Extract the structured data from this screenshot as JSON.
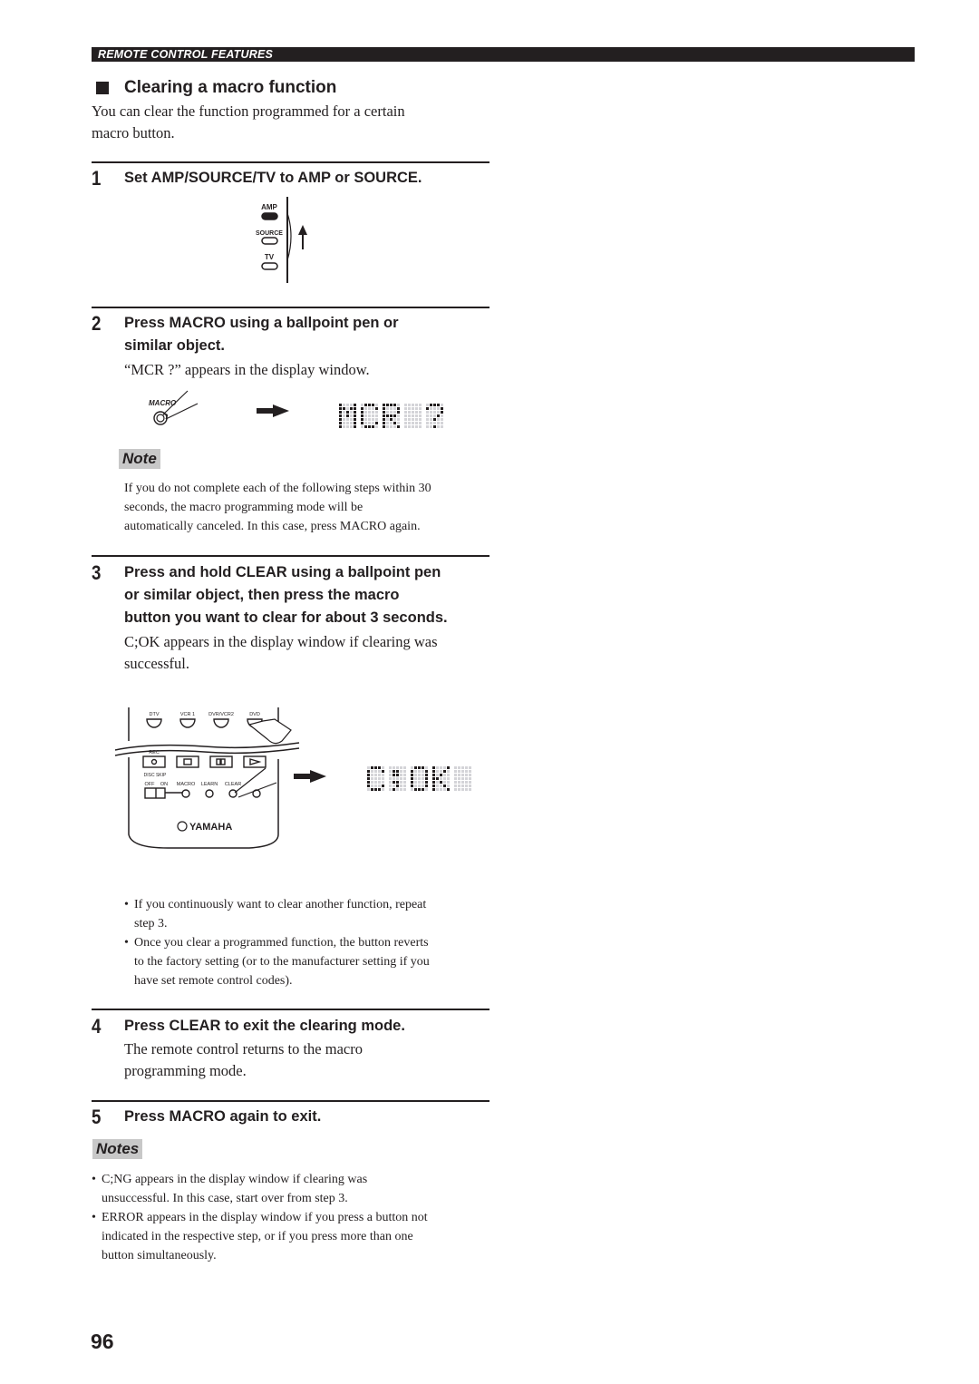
{
  "header": {
    "section_label": "REMOTE CONTROL FEATURES"
  },
  "section": {
    "title": "Clearing a macro function",
    "intro_line1": "You can clear the function programmed for a certain",
    "intro_line2": "macro button."
  },
  "steps": [
    {
      "number": "1",
      "heading": "Set AMP/SOURCE/TV to AMP or SOURCE.",
      "figure": {
        "switch_labels": [
          "AMP",
          "SOURCE",
          "TV"
        ],
        "arrow": "up-arrow"
      }
    },
    {
      "number": "2",
      "heading_line1": "Press MACRO using a ballpoint pen or",
      "heading_line2": "similar object.",
      "body": "“MCR ?” appears in the display window.",
      "figure": {
        "button_label": "MACRO",
        "display_text": "MCR ?"
      }
    },
    {
      "number": "3",
      "heading_line1": "Press and hold CLEAR using a ballpoint pen",
      "heading_line2": "or similar object, then press the macro",
      "heading_line3": "button you want to clear for about 3 seconds.",
      "body_line1": "C;OK appears in the display window if clearing was",
      "body_line2": "successful.",
      "figure": {
        "top_buttons": [
          "DTV",
          "VCR 1",
          "DVR/VCR2",
          "DVD"
        ],
        "rec_label": "REC",
        "disc_skip_label": "DISC SKIP",
        "switch_off": "OFF",
        "switch_on": "ON",
        "bottom_buttons": [
          "MACRO",
          "LEARN",
          "CLEAR"
        ],
        "brand": "YAMAHA",
        "display_text": "C;OK"
      },
      "bullets": [
        {
          "line1": "If you continuously want to clear another function, repeat",
          "line2": "step 3."
        },
        {
          "line1": "Once you clear a programmed function, the button reverts",
          "line2": "to the factory setting (or to the manufacturer setting if you",
          "line3": "have set remote control codes)."
        }
      ]
    },
    {
      "number": "4",
      "heading": "Press CLEAR to exit the clearing mode.",
      "body_line1": "The remote control returns to the macro",
      "body_line2": "programming mode."
    },
    {
      "number": "5",
      "heading": "Press MACRO again to exit."
    }
  ],
  "note": {
    "label": "Note",
    "line1": "If you do not complete each of the following steps within 30",
    "line2": "seconds, the macro programming mode will be",
    "line3": "automatically canceled. In this case, press MACRO again."
  },
  "notes": {
    "label": "Notes",
    "items": [
      {
        "line1": "C;NG appears in the display window if clearing was",
        "line2": "unsuccessful. In this case, start over from step 3."
      },
      {
        "line1": "ERROR appears in the display window if you press a button not",
        "line2": "indicated in the respective step, or if you press more than one",
        "line3": "button simultaneously."
      }
    ]
  },
  "page_number": "96"
}
